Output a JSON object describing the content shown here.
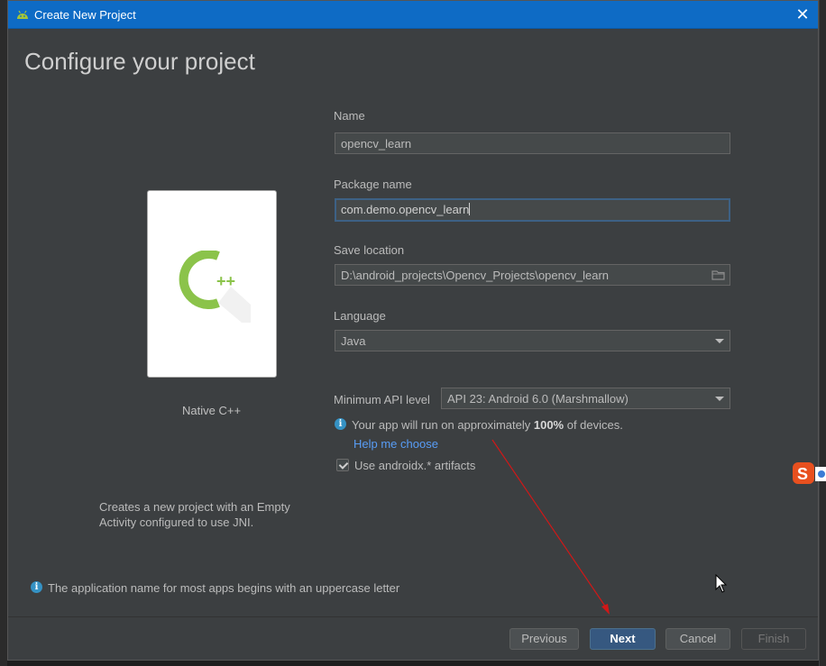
{
  "window": {
    "title": "Create New Project"
  },
  "page": {
    "heading": "Configure your project"
  },
  "template": {
    "name": "Native C++",
    "icon_text": "C++",
    "description": "Creates a new project with an Empty Activity configured to use JNI."
  },
  "form": {
    "name_label": "Name",
    "name_value": "opencv_learn",
    "package_label": "Package name",
    "package_value": "com.demo.opencv_learn",
    "location_label": "Save location",
    "location_value": "D:\\android_projects\\Opencv_Projects\\opencv_learn",
    "language_label": "Language",
    "language_value": "Java",
    "api_label": "Minimum API level",
    "api_value": "API 23: Android 6.0 (Marshmallow)",
    "api_info_prefix": "Your app will run on approximately ",
    "api_info_percent": "100%",
    "api_info_suffix": " of devices.",
    "help_link": "Help me choose",
    "androidx_label": "Use androidx.* artifacts",
    "androidx_checked": true
  },
  "hint": "The application name for most apps begins with an uppercase letter",
  "buttons": {
    "previous": "Previous",
    "next": "Next",
    "cancel": "Cancel",
    "finish": "Finish"
  },
  "colors": {
    "titlebar": "#0e6bc5",
    "dialog_bg": "#3c3f41",
    "link": "#589df6",
    "primary_button": "#365880",
    "annotation_arrow": "#d01818"
  },
  "icons": [
    "android-icon",
    "close-icon",
    "cpp-icon",
    "folder-icon",
    "dropdown-arrow-icon",
    "info-icon",
    "checkmark-icon",
    "sogou-ime-icon",
    "mouse-cursor-icon"
  ]
}
